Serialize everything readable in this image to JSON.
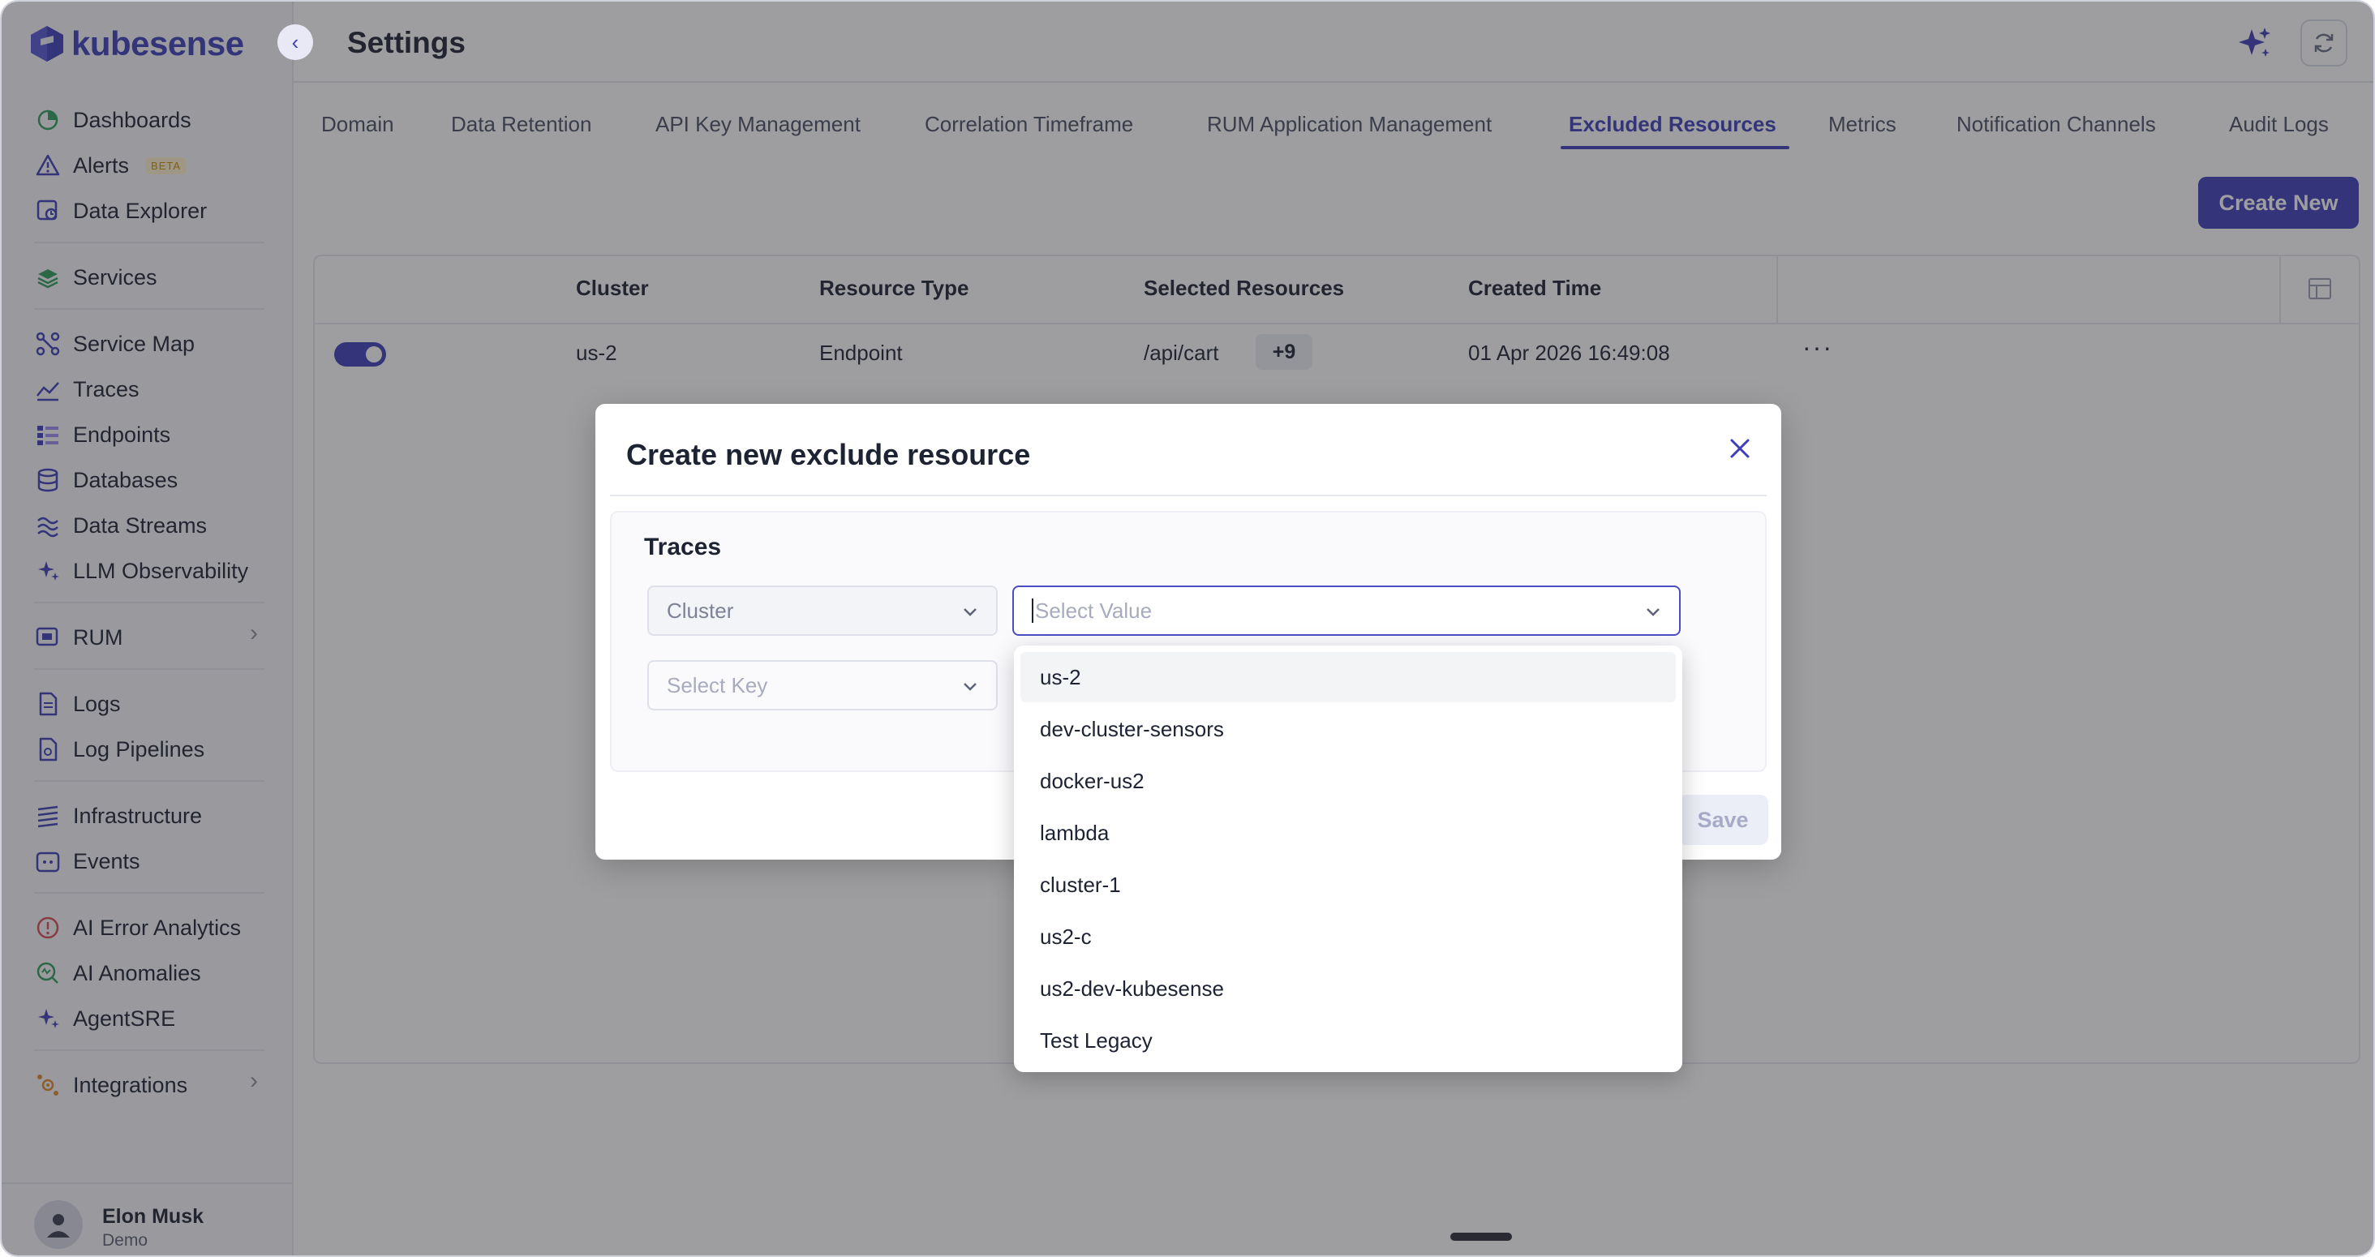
{
  "app": {
    "brand": "kubesense",
    "page_title": "Settings"
  },
  "sidebar": {
    "items": [
      {
        "label": "Dashboards",
        "icon": "dashboards-icon"
      },
      {
        "label": "Alerts",
        "icon": "alert-icon",
        "badge": "BETA"
      },
      {
        "label": "Data Explorer",
        "icon": "data-explorer-icon"
      },
      {
        "label": "Services",
        "icon": "services-icon"
      },
      {
        "label": "Service Map",
        "icon": "service-map-icon"
      },
      {
        "label": "Traces",
        "icon": "traces-icon"
      },
      {
        "label": "Endpoints",
        "icon": "endpoints-icon"
      },
      {
        "label": "Databases",
        "icon": "database-icon"
      },
      {
        "label": "Data Streams",
        "icon": "data-streams-icon"
      },
      {
        "label": "LLM Observability",
        "icon": "sparkle-icon"
      },
      {
        "label": "RUM",
        "icon": "rum-icon"
      },
      {
        "label": "Logs",
        "icon": "logs-icon"
      },
      {
        "label": "Log Pipelines",
        "icon": "log-pipelines-icon"
      },
      {
        "label": "Infrastructure",
        "icon": "infrastructure-icon"
      },
      {
        "label": "Events",
        "icon": "events-icon"
      },
      {
        "label": "AI Error Analytics",
        "icon": "error-icon"
      },
      {
        "label": "AI Anomalies",
        "icon": "anomalies-icon"
      },
      {
        "label": "AgentSRE",
        "icon": "sparkle-icon"
      },
      {
        "label": "Integrations",
        "icon": "integrations-icon"
      }
    ],
    "user": {
      "name": "Elon Musk",
      "role": "Demo"
    }
  },
  "tabs": [
    "Domain",
    "Data Retention",
    "API Key Management",
    "Correlation Timeframe",
    "RUM Application Management",
    "Excluded Resources",
    "Metrics",
    "Notification Channels",
    "Audit Logs"
  ],
  "active_tab": "Excluded Resources",
  "toolbar": {
    "create_label": "Create New"
  },
  "table": {
    "columns": [
      "Cluster",
      "Resource Type",
      "Selected Resources",
      "Created Time"
    ],
    "rows": [
      {
        "enabled": true,
        "cluster": "us-2",
        "resource_type": "Endpoint",
        "selected_resources": "/api/cart",
        "extra_count": "+9",
        "created_time": "01 Apr 2026 16:49:08",
        "actions": "···"
      }
    ]
  },
  "modal": {
    "title": "Create new exclude resource",
    "section_title": "Traces",
    "key_select_value": "Cluster",
    "value_placeholder": "Select Value",
    "key_placeholder": "Select Key",
    "save_label": "Save"
  },
  "dropdown": {
    "options": [
      "us-2",
      "dev-cluster-sensors",
      "docker-us2",
      "lambda",
      "cluster-1",
      "us2-c",
      "us2-dev-kubesense",
      "Test Legacy"
    ]
  },
  "colors": {
    "accent": "#3d3fb8",
    "overlay": "rgba(40,40,44,0.45)"
  }
}
